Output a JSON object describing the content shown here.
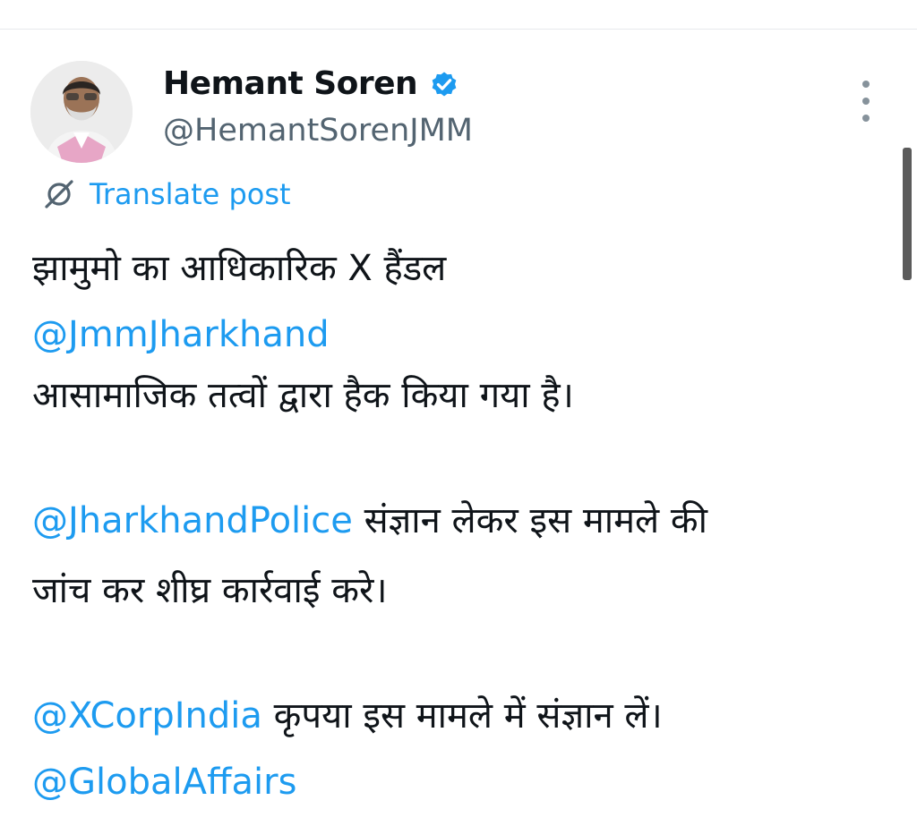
{
  "author": {
    "display_name": "Hemant Soren",
    "handle": "@HemantSorenJMM",
    "verified": true,
    "avatar": "profile-photo"
  },
  "actions": {
    "more_icon": "more-vertical-icon",
    "translate_icon": "translate-globe-icon",
    "translate_label": "Translate post"
  },
  "tweet": {
    "line1": "झामुमो का आधिकारिक X हैंडल",
    "mention1": "@JmmJharkhand",
    "line2": "आसामाजिक तत्वों द्वारा हैक किया गया है।",
    "mention2": "@JharkhandPolice",
    "line3a": " संज्ञान लेकर इस मामले की",
    "line3b": "जांच कर शीघ्र कार्रवाई करे।",
    "mention3": "@XCorpIndia",
    "line4": " कृपया इस मामले में संज्ञान लें।",
    "mention4": "@GlobalAffairs"
  },
  "colors": {
    "link": "#1d9bf0",
    "secondary_text": "#536471",
    "primary_text": "#0f1419",
    "verified_badge": "#1d9bf0"
  }
}
